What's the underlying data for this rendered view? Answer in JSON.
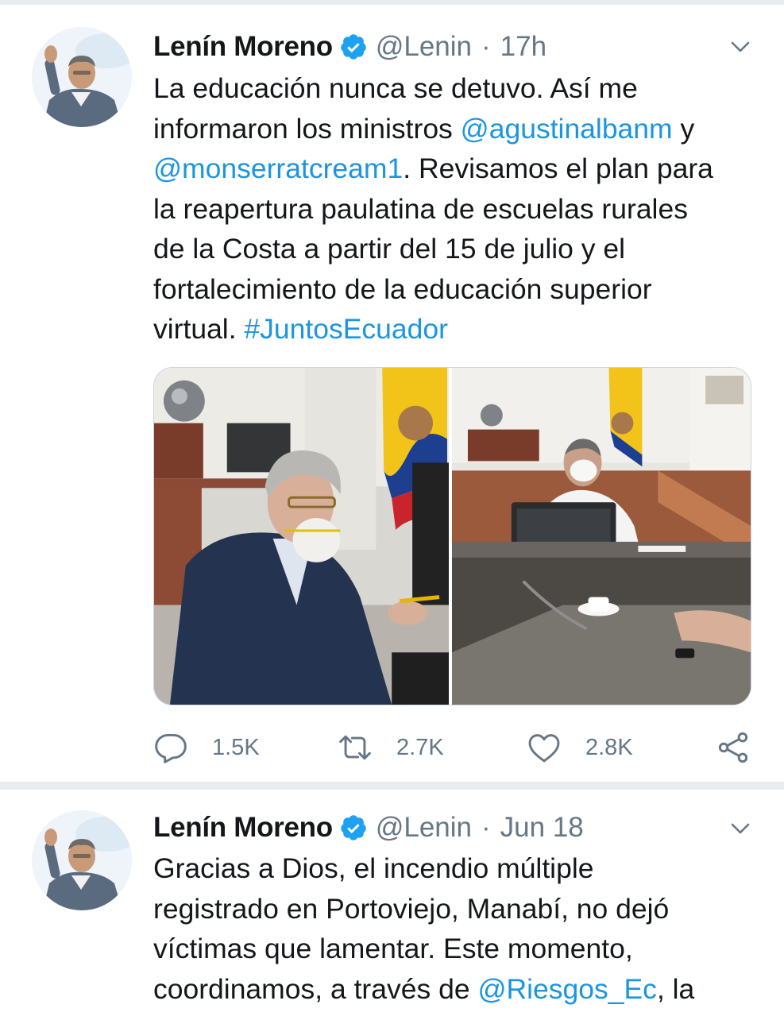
{
  "tweets": [
    {
      "author_name": "Lenín Moreno",
      "handle": "@Lenin",
      "separator": "·",
      "time": "17h",
      "text_lines": [
        [
          {
            "t": "La educación nunca se detuvo. Así me"
          }
        ],
        [
          {
            "t": "informaron los ministros "
          },
          {
            "t": "@agustinalbanm",
            "link": true
          },
          {
            "t": " y"
          }
        ],
        [
          {
            "t": "@monserratcream1",
            "link": true
          },
          {
            "t": ". Revisamos el plan para"
          }
        ],
        [
          {
            "t": "la reapertura paulatina de escuelas rurales"
          }
        ],
        [
          {
            "t": "de la Costa a partir del 15 de julio y el"
          }
        ],
        [
          {
            "t": "fortalecimiento de la educación superior"
          }
        ],
        [
          {
            "t": "virtual. "
          },
          {
            "t": "#JuntosEcuador",
            "link": true
          }
        ]
      ],
      "actions": {
        "reply_count": "1.5K",
        "retweet_count": "2.7K",
        "like_count": "2.8K"
      }
    },
    {
      "author_name": "Lenín Moreno",
      "handle": "@Lenin",
      "separator": "·",
      "time": "Jun 18",
      "text_lines": [
        [
          {
            "t": "Gracias a Dios, el incendio múltiple"
          }
        ],
        [
          {
            "t": "registrado en Portoviejo, Manabí, no dejó"
          }
        ],
        [
          {
            "t": "víctimas que lamentar. Este momento,"
          }
        ],
        [
          {
            "t": "coordinamos, a través de "
          },
          {
            "t": "@Riesgos_Ec",
            "link": true
          },
          {
            "t": ", la"
          }
        ]
      ]
    }
  ],
  "icons": {
    "verified": "verified-badge-icon",
    "chevron": "chevron-down-icon",
    "reply": "reply-icon",
    "retweet": "retweet-icon",
    "like": "heart-icon",
    "share": "share-icon"
  },
  "colors": {
    "link": "#1b95e0",
    "text": "#14171a",
    "secondary": "#657786",
    "verified": "#1da1f2",
    "feed_background": "#e6ecf0"
  }
}
